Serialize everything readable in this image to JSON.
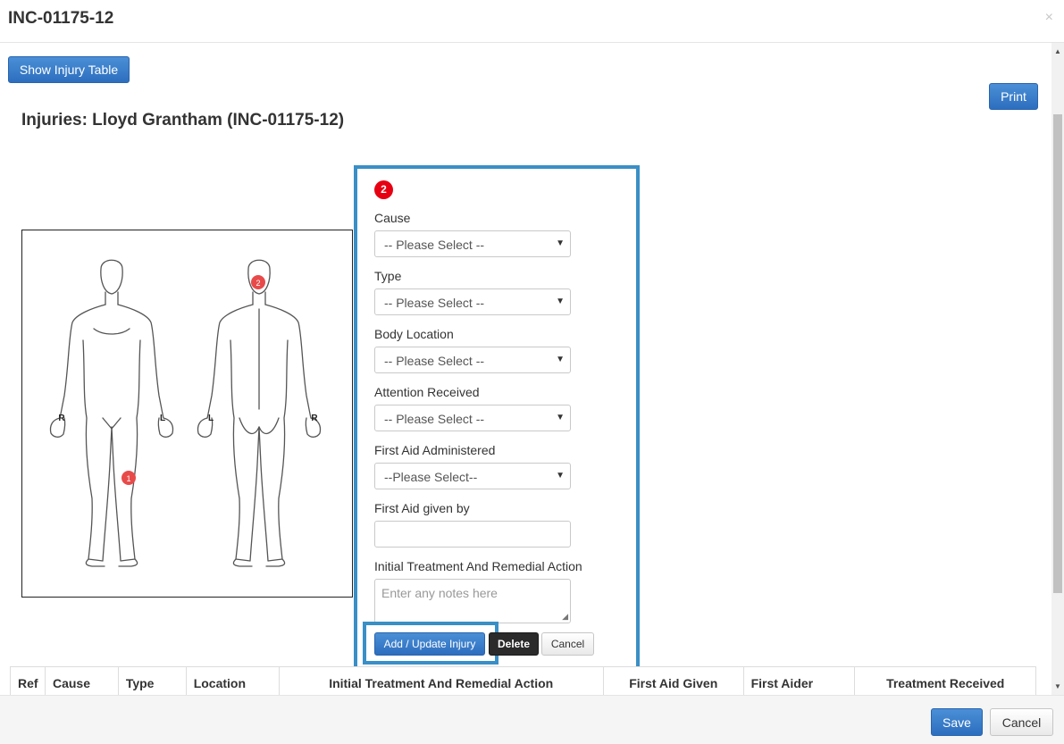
{
  "modal": {
    "title": "INC-01175-12",
    "close_glyph": "×"
  },
  "toolbar": {
    "show_table_label": "Show Injury Table",
    "print_label": "Print"
  },
  "injuries_title": "Injuries: Lloyd Grantham (INC-01175-12)",
  "diagram": {
    "markers": [
      {
        "number": "1",
        "view": "front",
        "location": "left knee"
      },
      {
        "number": "2",
        "view": "back",
        "location": "head"
      }
    ],
    "front_side_labels": {
      "left_hand": "R",
      "right_hand": "L"
    },
    "back_side_labels": {
      "left_hand": "L",
      "right_hand": "R"
    },
    "marker_color": "#e84a4a"
  },
  "form": {
    "selected_marker": "2",
    "marker_color": "#e60012",
    "fields": {
      "cause": {
        "label": "Cause",
        "value": "-- Please Select --"
      },
      "type": {
        "label": "Type",
        "value": "-- Please Select --"
      },
      "body_location": {
        "label": "Body Location",
        "value": "-- Please Select --"
      },
      "attention": {
        "label": "Attention Received",
        "value": "-- Please Select --"
      },
      "first_aid": {
        "label": "First Aid Administered",
        "value": "--Please Select--"
      },
      "first_aid_by": {
        "label": "First Aid given by",
        "value": ""
      },
      "treatment": {
        "label": "Initial Treatment And Remedial Action",
        "placeholder": "Enter any notes here"
      }
    },
    "buttons": {
      "add": "Add / Update Injury",
      "delete": "Delete",
      "cancel": "Cancel"
    },
    "highlight_color": "#3a8fc6"
  },
  "table": {
    "headers": [
      "Ref",
      "Cause",
      "Type",
      "Location",
      "Initial Treatment And Remedial Action",
      "First Aid Given",
      "First Aider",
      "Treatment Received"
    ]
  },
  "footer": {
    "save_label": "Save",
    "cancel_label": "Cancel"
  }
}
